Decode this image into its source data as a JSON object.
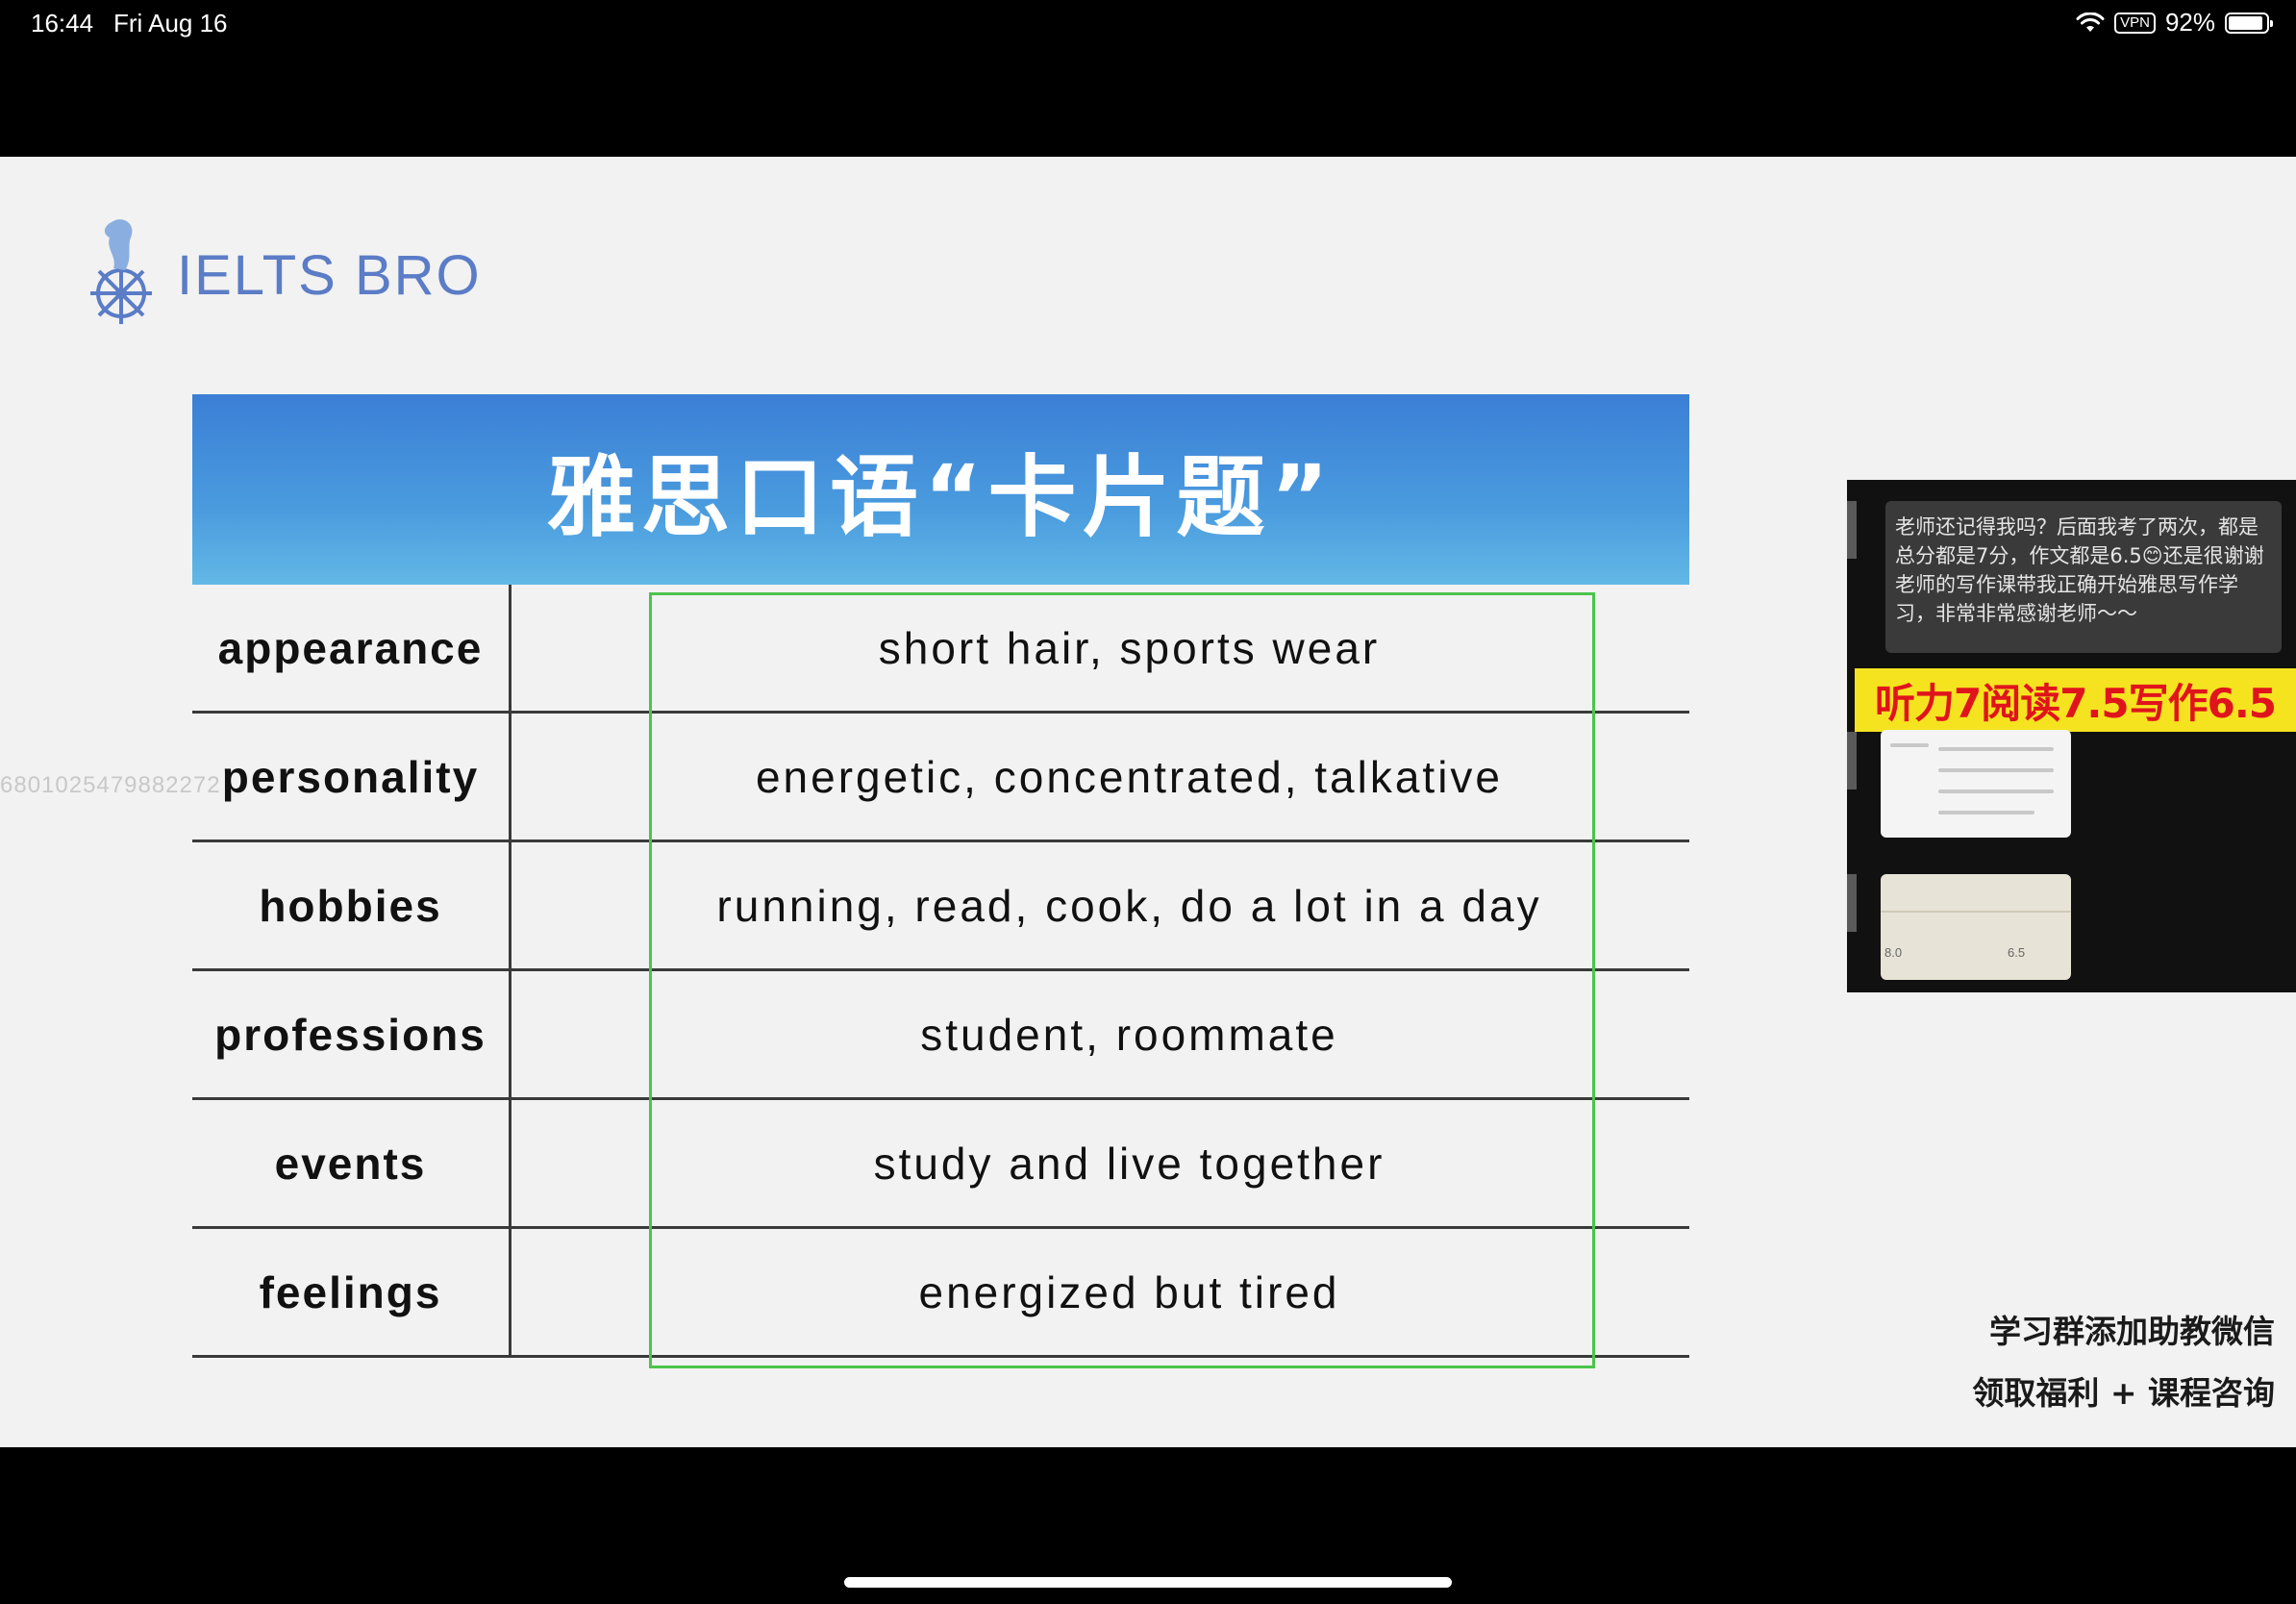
{
  "status_bar": {
    "time": "16:44",
    "date": "Fri Aug 16",
    "vpn": "VPN",
    "battery": "92%",
    "battery_level": 0.92
  },
  "slide": {
    "logo_text": "IELTS BRO",
    "title": "雅思口语“卡片题”",
    "watermark_id": "6801025479882272",
    "rows": [
      {
        "label": "appearance",
        "value": "short hair, sports wear"
      },
      {
        "label": "personality",
        "value": "energetic, concentrated, talkative"
      },
      {
        "label": "hobbies",
        "value": "running, read, cook, do a lot in a day"
      },
      {
        "label": "professions",
        "value": "student, roommate"
      },
      {
        "label": "events",
        "value": "study and live together"
      },
      {
        "label": "feelings",
        "value": "energized but tired"
      }
    ],
    "colors": {
      "header_blue": "#3b7fd6",
      "highlight_green": "#4cc44c",
      "logo_blue": "#5b7cc6"
    }
  },
  "ad": {
    "chat_message": "老师还记得我吗？后面我考了两次，都是总分都是7分，作文都是6.5😊还是很谢谢老师的写作课带我正确开始雅思写作学习，非常非常感谢老师～～",
    "banner": "听力7阅读7.5写作6.5",
    "score_card_b_values": [
      "8.0",
      "6.5"
    ],
    "banner_colors": {
      "background": "#f5e320",
      "text": "#e0141c"
    }
  },
  "cta": {
    "line1": "学习群添加助教微信",
    "line2": "领取福利 + 课程咨询"
  }
}
